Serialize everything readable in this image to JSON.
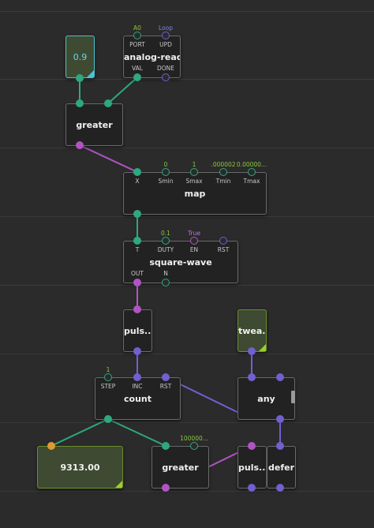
{
  "colors": {
    "green": "#2ea87e",
    "purple": "#b054c4",
    "blue": "#7060d0",
    "orange": "#e09a30",
    "value_green": "#8cc63f",
    "value_purple": "#c070e0",
    "value_blue": "#8080f0"
  },
  "nodes": {
    "const_09": {
      "value": "0.9"
    },
    "analog_read": {
      "title": "analog-read",
      "port_label": "PORT",
      "port_value": "A0",
      "upd_label": "UPD",
      "upd_value": "Loop",
      "val_label": "VAL",
      "done_label": "DONE"
    },
    "greater_top": {
      "title": "greater"
    },
    "map": {
      "title": "map",
      "x_label": "X",
      "smin_label": "Smin",
      "smin_value": "0",
      "smax_label": "Smax",
      "smax_value": "1",
      "tmin_label": "Tmin",
      "tmin_value": ".000002",
      "tmax_label": "Tmax",
      "tmax_value": "0.00000..."
    },
    "square_wave": {
      "title": "square-wave",
      "t_label": "T",
      "duty_label": "DUTY",
      "duty_value": "0.1",
      "en_label": "EN",
      "en_value": "True",
      "rst_label": "RST",
      "out_label": "OUT",
      "n_label": "N"
    },
    "puls_top": {
      "title": "puls..."
    },
    "tweak": {
      "title": "twea..."
    },
    "count": {
      "title": "count",
      "step_label": "STEP",
      "step_value": "1",
      "inc_label": "INC",
      "rst_label": "RST"
    },
    "any": {
      "title": "any"
    },
    "watch": {
      "value": "9313.00"
    },
    "greater_bottom": {
      "title": "greater",
      "value": "100000..."
    },
    "puls_bottom": {
      "title": "puls..."
    },
    "defer": {
      "title": "defer"
    }
  }
}
